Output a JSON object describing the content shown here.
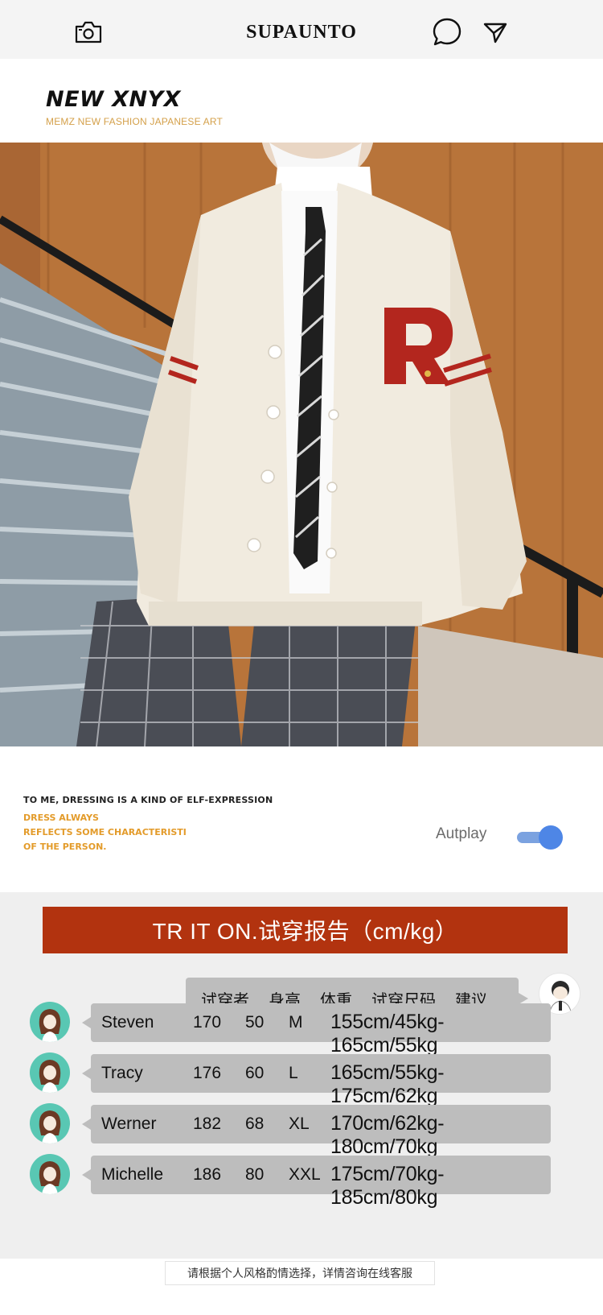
{
  "topbar": {
    "brand": "SUPAUNTO",
    "icons": [
      "camera-icon",
      "chat-bubble-icon",
      "send-icon"
    ]
  },
  "hero": {
    "title": "NEW XNYX",
    "subtitle": "MEMZ NEW FASHION JAPANESE ART"
  },
  "photo": {
    "description_icon": "product-photo",
    "colors": {
      "wall": "#b8743a",
      "stairs": "#8c9aa3",
      "cardigan": "#f1ebdf",
      "patch": "#b3261e",
      "tie": "#1f1f1f"
    }
  },
  "slogan": {
    "line1": "TO ME, DRESSING IS A KIND OF   ELF-EXPRESSION",
    "line2": "DRESS ALWAYS\nREFLECTS SOME CHARACTERISTI\nOF THE PERSON."
  },
  "autoplay": {
    "label": "Autplay",
    "enabled": true,
    "accent": "#4e86e6"
  },
  "report": {
    "banner": "TR   IT ON.试穿报告（cm/kg）",
    "banner_color": "#b2330f",
    "headers": [
      "试穿者",
      "身高",
      "体重",
      "试穿尺码",
      "建议"
    ],
    "rows": [
      {
        "name": "Steven",
        "height": "170",
        "weight": "50",
        "size": "M",
        "range": "155cm/45kg-165cm/55kg"
      },
      {
        "name": "Tracy",
        "height": "176",
        "weight": "60",
        "size": "L",
        "range": "165cm/55kg-175cm/62kg"
      },
      {
        "name": "Werner",
        "height": "182",
        "weight": "68",
        "size": "XL",
        "range": "170cm/62kg-180cm/70kg"
      },
      {
        "name": "Michelle",
        "height": "186",
        "weight": "80",
        "size": "XXL",
        "range": "175cm/70kg-185cm/80kg"
      }
    ]
  },
  "footnote": "请根据个人风格酌情选择，详情咨询在线客服"
}
